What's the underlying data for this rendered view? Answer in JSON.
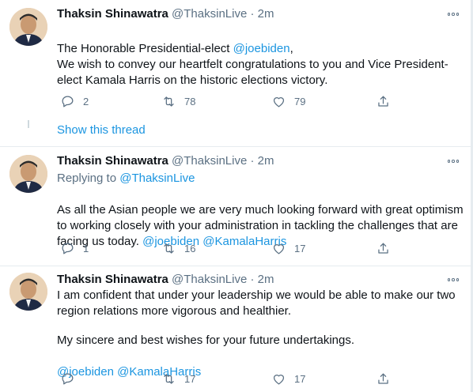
{
  "user": {
    "name": "Thaksin Shinawatra",
    "handle": "@ThaksinLive",
    "separator": "·"
  },
  "icons": {
    "reply": "reply-icon",
    "retweet": "retweet-icon",
    "like": "heart-icon",
    "share": "share-icon",
    "more": "more-icon"
  },
  "colors": {
    "link": "#1b95e0",
    "muted": "#5b7083",
    "text": "#0f1419"
  },
  "show_thread": "Show this thread",
  "tweets": [
    {
      "time": "2m",
      "line1_pre": "The Honorable Presidential-elect ",
      "line1_mention": "@joebiden",
      "line1_post": ",",
      "body": "We wish to convey our heartfelt congratulations to you and Vice President-elect Kamala Harris on the historic elections victory.",
      "replies": "2",
      "retweets": "78",
      "likes": "79"
    },
    {
      "time": "2m",
      "replying_label": "Replying to ",
      "replying_handle": "@ThaksinLive",
      "body": "As all the Asian people we are very much looking forward with great optimism to working closely with your administration in tackling the challenges that are facing us today. ",
      "mention1": "@joebiden",
      "mention2": "@KamalaHarris",
      "replies": "1",
      "retweets": "16",
      "likes": "17"
    },
    {
      "time": "2m",
      "body1": "I am confident that under your leadership we would be able to make our two region relations more vigorous and healthier.",
      "body2": "My sincere and best wishes for your future undertakings.",
      "mention1": "@joebiden",
      "mention2": "@KamalaHarris",
      "retweets": "17",
      "likes": "17"
    }
  ]
}
